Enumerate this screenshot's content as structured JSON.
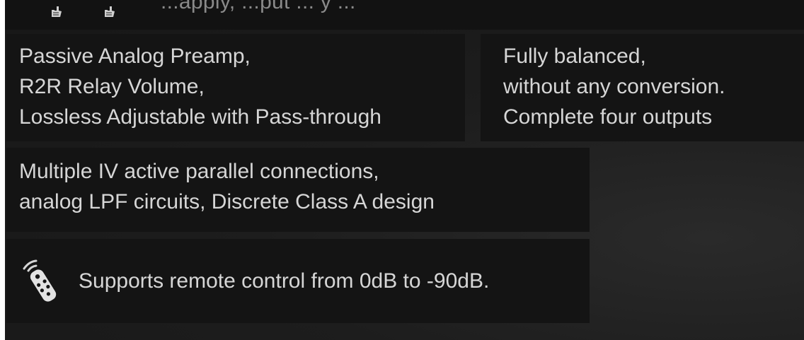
{
  "top_strip": {
    "icons": [
      "hand-pointer-icon",
      "hand-pointer-icon"
    ],
    "partial_text": "...apply, ...put ... y ..."
  },
  "features": {
    "preamp": {
      "lines": [
        "Passive Analog Preamp,",
        "R2R Relay Volume,",
        "Lossless Adjustable with Pass-through"
      ]
    },
    "balanced": {
      "lines": [
        "Fully balanced,",
        "without any conversion.",
        "Complete four outputs"
      ]
    },
    "iv": {
      "lines": [
        "Multiple IV active parallel connections,",
        "analog LPF circuits, Discrete Class A design"
      ]
    },
    "remote": {
      "icon": "remote-control-icon",
      "text": "Supports remote control from 0dB to -90dB."
    }
  },
  "colors": {
    "background": "#1b1b1b",
    "panel": "#141414",
    "text": "#d6d6d6"
  }
}
